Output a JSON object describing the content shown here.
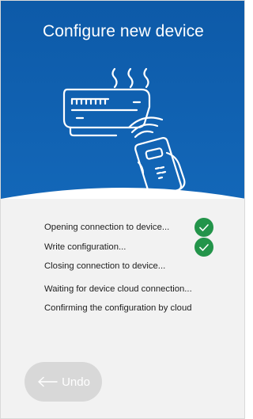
{
  "title": "Configure new device",
  "colors": {
    "header_blue": "#0f5fae",
    "check_green": "#23944a",
    "content_bg": "#f2f2f2",
    "undo_bg": "#d8d8d8"
  },
  "illustration": {
    "icon": "device-config-illustration",
    "description_icons": [
      "air-conditioner-icon",
      "heat-waves-icon",
      "phone-in-hand-icon",
      "nfc-signal-icon"
    ]
  },
  "steps": [
    {
      "label": "Opening connection to device...",
      "done": true
    },
    {
      "label": "Write configuration...",
      "done": true
    },
    {
      "label": "Closing connection to device...",
      "done": false
    },
    {
      "label": "Waiting for device cloud connection...",
      "done": false
    },
    {
      "label": "Confirming the configuration by cloud",
      "done": false
    }
  ],
  "undo": {
    "label": "Undo",
    "icon": "arrow-left-icon",
    "enabled": false
  }
}
